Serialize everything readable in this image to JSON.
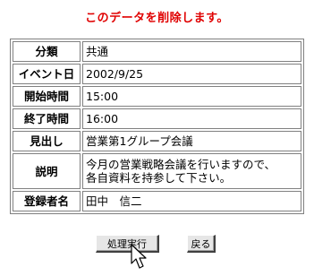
{
  "page": {
    "notice": "このデータを削除します。",
    "notice_color": "#e00000"
  },
  "rows": [
    {
      "label": "分類",
      "value": "共通"
    },
    {
      "label": "イベント日",
      "value": "2002/9/25"
    },
    {
      "label": "開始時間",
      "value": "15:00"
    },
    {
      "label": "終了時間",
      "value": "16:00"
    },
    {
      "label": "見出し",
      "value": "営業第1グループ会議"
    },
    {
      "label": "説明",
      "value_line1": "今月の営業戦略会議を行いますので、",
      "value_line2": "各自資料を持参して下さい。"
    },
    {
      "label": "登録者名",
      "value": "田中　信二"
    }
  ],
  "buttons": {
    "process": "処理実行",
    "back": "戻る"
  },
  "icons": {
    "cursor": "pointer-cursor-icon"
  }
}
